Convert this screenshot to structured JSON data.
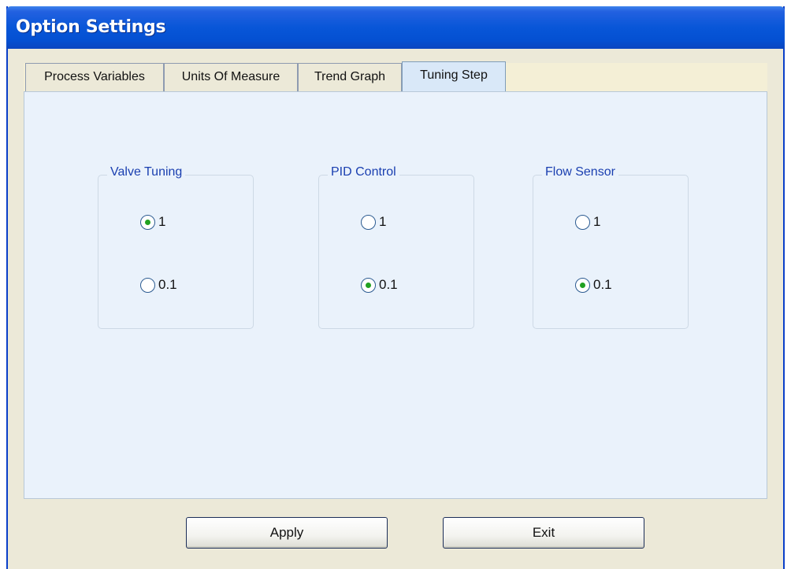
{
  "window": {
    "title": "Option Settings"
  },
  "tabs": [
    {
      "label": "Process Variables",
      "active": false
    },
    {
      "label": "Units Of Measure",
      "active": false
    },
    {
      "label": "Trend Graph",
      "active": false
    },
    {
      "label": "Tuning Step",
      "active": true
    }
  ],
  "groups": [
    {
      "label": "Valve Tuning",
      "options": [
        {
          "label": "1",
          "checked": true
        },
        {
          "label": "0.1",
          "checked": false
        }
      ]
    },
    {
      "label": "PID Control",
      "options": [
        {
          "label": "1",
          "checked": false
        },
        {
          "label": "0.1",
          "checked": true
        }
      ]
    },
    {
      "label": "Flow Sensor",
      "options": [
        {
          "label": "1",
          "checked": false
        },
        {
          "label": "0.1",
          "checked": true
        }
      ]
    }
  ],
  "buttons": {
    "apply_label": "Apply",
    "exit_label": "Exit"
  },
  "colors": {
    "title_bar": "#0856d8",
    "panel_background": "#eaf2fb",
    "group_label": "#1a3fb0",
    "radio_dot": "#21a121"
  }
}
